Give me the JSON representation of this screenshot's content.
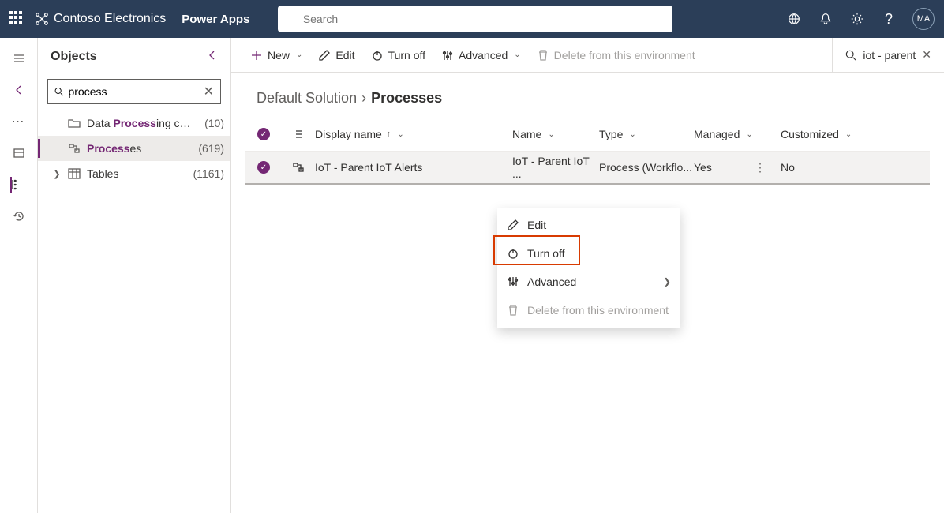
{
  "topbar": {
    "org": "Contoso Electronics",
    "app": "Power Apps",
    "search_placeholder": "Search",
    "avatar": "MA"
  },
  "panel": {
    "title": "Objects",
    "search_value": "process",
    "items": [
      {
        "label_pre": "Data ",
        "label_hl": "Process",
        "label_post": "ing con...",
        "count": "(10)",
        "icon": "folder"
      },
      {
        "label_pre": "",
        "label_hl": "Process",
        "label_post": "es",
        "count": "(619)",
        "icon": "flow",
        "active": true
      },
      {
        "label_pre": "Tables",
        "label_hl": "",
        "label_post": "",
        "count": "(1161)",
        "icon": "table",
        "expandable": true
      }
    ]
  },
  "cmd": {
    "new": "New",
    "edit": "Edit",
    "turnoff": "Turn off",
    "advanced": "Advanced",
    "delete": "Delete from this environment"
  },
  "filter": {
    "text": "iot - parent"
  },
  "crumbs": {
    "root": "Default Solution",
    "current": "Processes"
  },
  "grid": {
    "cols": {
      "display": "Display name",
      "name": "Name",
      "type": "Type",
      "managed": "Managed",
      "customized": "Customized"
    },
    "row": {
      "display": "IoT - Parent IoT Alerts",
      "name": "IoT - Parent IoT ...",
      "type": "Process (Workflo...",
      "managed": "Yes",
      "customized": "No"
    }
  },
  "ctx": {
    "edit": "Edit",
    "turnoff": "Turn off",
    "advanced": "Advanced",
    "delete": "Delete from this environment"
  }
}
